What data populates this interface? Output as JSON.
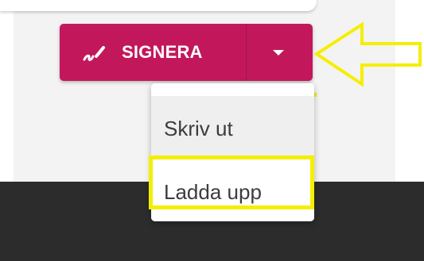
{
  "toolbar": {
    "sign_label": "SIGNERA",
    "sign_icon": "pen-sign-icon",
    "dropdown_icon": "caret-down-icon",
    "accent_color": "#c2185b"
  },
  "menu": {
    "items": [
      {
        "label": "Skriv ut",
        "state": "hover"
      },
      {
        "label": "Ladda upp",
        "state": "highlighted"
      }
    ]
  },
  "annotation": {
    "arrow_icon": "arrow-left-icon",
    "highlight_color": "#f4ef00"
  }
}
